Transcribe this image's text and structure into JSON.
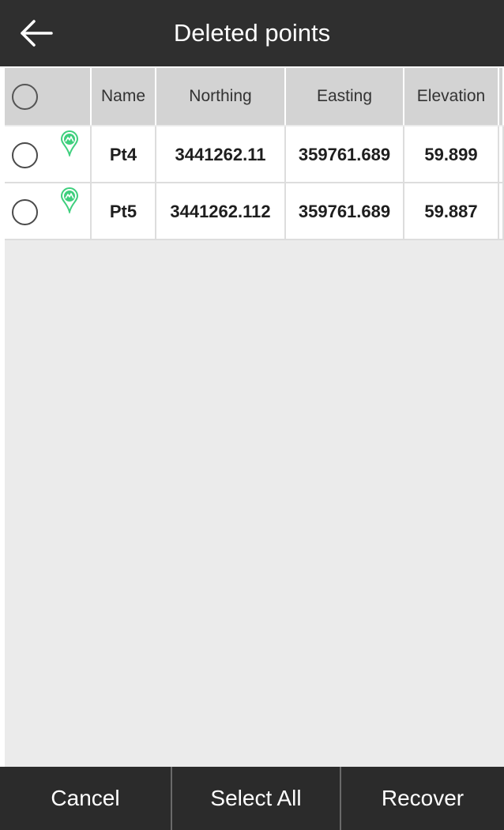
{
  "header": {
    "title": "Deleted points",
    "back_icon": "arrow-left-icon"
  },
  "table": {
    "columns": [
      "",
      "Name",
      "Northing",
      "Easting",
      "Elevation"
    ],
    "rows": [
      {
        "name": "Pt4",
        "northing": "3441262.11",
        "easting": "359761.689",
        "elevation": "59.899",
        "icon": "point-pin-icon"
      },
      {
        "name": "Pt5",
        "northing": "3441262.112",
        "easting": "359761.689",
        "elevation": "59.887",
        "icon": "point-pin-icon"
      }
    ]
  },
  "footer": {
    "cancel_label": "Cancel",
    "select_all_label": "Select All",
    "recover_label": "Recover"
  },
  "colors": {
    "header_bg": "#2f2f2f",
    "pin_green": "#3ecf7d",
    "footer_bg": "#2b2b2b"
  }
}
